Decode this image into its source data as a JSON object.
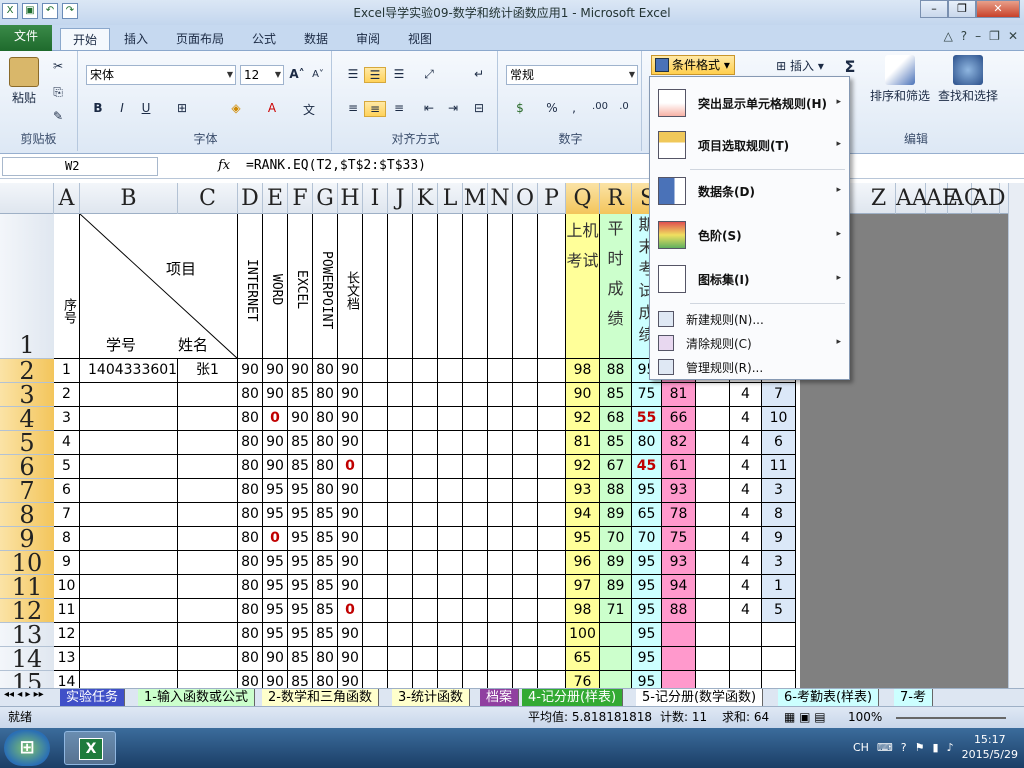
{
  "window": {
    "title": "Excel导学实验09-数学和统计函数应用1 - Microsoft Excel"
  },
  "ribbon_tabs": [
    "文件",
    "开始",
    "插入",
    "页面布局",
    "公式",
    "数据",
    "审阅",
    "视图"
  ],
  "ribbon": {
    "paste": "粘贴",
    "clipboard": "剪贴板",
    "font_name": "宋体",
    "font_size": "12",
    "font_group": "字体",
    "align_group": "对齐方式",
    "number_format": "常规",
    "number_group": "数字",
    "cf_button": "条件格式",
    "insert": "插入",
    "edit_group": "编辑",
    "sort_filter": "排序和筛选",
    "find_select": "查找和选择",
    "bold": "B",
    "italic": "I",
    "underline": "U"
  },
  "formula_bar": {
    "cell_ref": "W2",
    "fx": "fx",
    "formula": "=RANK.EQ(T2,$T$2:$T$33)"
  },
  "cf_menu": {
    "items": [
      {
        "label": "突出显示单元格规则(H)",
        "arrow": "▸"
      },
      {
        "label": "项目选取规则(T)",
        "arrow": "▸"
      },
      {
        "label": "数据条(D)",
        "arrow": "▸"
      },
      {
        "label": "色阶(S)",
        "arrow": "▸"
      },
      {
        "label": "图标集(I)",
        "arrow": "▸"
      }
    ],
    "small_items": [
      {
        "label": "新建规则(N)...",
        "arrow": ""
      },
      {
        "label": "清除规则(C)",
        "arrow": "▸"
      },
      {
        "label": "管理规则(R)...",
        "arrow": ""
      }
    ]
  },
  "columns": [
    "A",
    "B",
    "C",
    "D",
    "E",
    "F",
    "G",
    "H",
    "I",
    "J",
    "K",
    "L",
    "M",
    "N",
    "O",
    "P",
    "Q",
    "R",
    "S",
    "Z",
    "AA",
    "AE",
    "AC",
    "AD"
  ],
  "header_row": {
    "a": "序号",
    "xiangmu": "项目",
    "xuehao": "学号",
    "xingming": "姓名",
    "d": "INTERNET",
    "e": "WORD",
    "f": "EXCEL",
    "g": "POWERPOINT",
    "h": "长文档",
    "q": "上机考试",
    "r": "平时成绩",
    "s": "期末考试成绩"
  },
  "row_numbers": [
    "1",
    "2",
    "3",
    "4",
    "5",
    "6",
    "7",
    "8",
    "9",
    "10",
    "11",
    "12",
    "13",
    "14",
    "15"
  ],
  "rows": [
    {
      "a": "1",
      "b": "1404333601",
      "c": "张1",
      "d": "90",
      "e": "90",
      "f": "90",
      "g": "80",
      "h": "90",
      "q": "98",
      "r": "88",
      "s": "95",
      "t": "",
      "v": "",
      "w": ""
    },
    {
      "a": "2",
      "b": "",
      "c": "",
      "d": "80",
      "e": "90",
      "f": "85",
      "g": "80",
      "h": "90",
      "q": "90",
      "r": "85",
      "s": "75",
      "t": "81",
      "v": "4",
      "w": "7"
    },
    {
      "a": "3",
      "b": "",
      "c": "",
      "d": "80",
      "e": "0",
      "f": "90",
      "g": "80",
      "h": "90",
      "q": "92",
      "r": "68",
      "s": "55",
      "t": "66",
      "v": "4",
      "w": "10"
    },
    {
      "a": "4",
      "b": "",
      "c": "",
      "d": "80",
      "e": "90",
      "f": "85",
      "g": "80",
      "h": "90",
      "q": "81",
      "r": "85",
      "s": "80",
      "t": "82",
      "v": "4",
      "w": "6"
    },
    {
      "a": "5",
      "b": "",
      "c": "",
      "d": "80",
      "e": "90",
      "f": "85",
      "g": "80",
      "h": "0",
      "q": "92",
      "r": "67",
      "s": "45",
      "t": "61",
      "v": "4",
      "w": "11"
    },
    {
      "a": "6",
      "b": "",
      "c": "",
      "d": "80",
      "e": "95",
      "f": "95",
      "g": "80",
      "h": "90",
      "q": "93",
      "r": "88",
      "s": "95",
      "t": "93",
      "v": "4",
      "w": "3"
    },
    {
      "a": "7",
      "b": "",
      "c": "",
      "d": "80",
      "e": "95",
      "f": "95",
      "g": "85",
      "h": "90",
      "q": "94",
      "r": "89",
      "s": "65",
      "t": "78",
      "v": "4",
      "w": "8"
    },
    {
      "a": "8",
      "b": "",
      "c": "",
      "d": "80",
      "e": "0",
      "f": "95",
      "g": "85",
      "h": "90",
      "q": "95",
      "r": "70",
      "s": "70",
      "t": "75",
      "v": "4",
      "w": "9"
    },
    {
      "a": "9",
      "b": "",
      "c": "",
      "d": "80",
      "e": "95",
      "f": "95",
      "g": "85",
      "h": "90",
      "q": "96",
      "r": "89",
      "s": "95",
      "t": "93",
      "v": "4",
      "w": "3"
    },
    {
      "a": "10",
      "b": "",
      "c": "",
      "d": "80",
      "e": "95",
      "f": "95",
      "g": "85",
      "h": "90",
      "q": "97",
      "r": "89",
      "s": "95",
      "t": "94",
      "v": "4",
      "w": "1"
    },
    {
      "a": "11",
      "b": "",
      "c": "",
      "d": "80",
      "e": "95",
      "f": "95",
      "g": "85",
      "h": "0",
      "q": "98",
      "r": "71",
      "s": "95",
      "t": "88",
      "v": "4",
      "w": "5"
    },
    {
      "a": "12",
      "b": "",
      "c": "",
      "d": "80",
      "e": "95",
      "f": "95",
      "g": "85",
      "h": "90",
      "q": "100",
      "r": "",
      "s": "95",
      "t": "",
      "v": "",
      "w": ""
    },
    {
      "a": "13",
      "b": "",
      "c": "",
      "d": "80",
      "e": "90",
      "f": "85",
      "g": "80",
      "h": "90",
      "q": "65",
      "r": "",
      "s": "95",
      "t": "",
      "v": "",
      "w": ""
    },
    {
      "a": "14",
      "b": "",
      "c": "",
      "d": "80",
      "e": "90",
      "f": "85",
      "g": "80",
      "h": "90",
      "q": "76",
      "r": "",
      "s": "95",
      "t": "",
      "v": "",
      "w": ""
    }
  ],
  "sheet_tabs": [
    "实验任务",
    "1-输入函数或公式",
    "2-数学和三角函数",
    "3-统计函数",
    "档案",
    "4-记分册(样表)",
    "5-记分册(数学函数)",
    "6-考勤表(样表)",
    "7-考"
  ],
  "status": {
    "ready": "就绪",
    "average": "平均值: 5.818181818",
    "count": "计数: 11",
    "sum": "求和: 64",
    "zoom": "100%"
  },
  "taskbar": {
    "lang": "CH",
    "time": "15:17",
    "date": "2015/5/29"
  },
  "colors": {
    "yellow": "#ffff99",
    "green": "#ccffcc",
    "cyan": "#ccffff",
    "pink": "#ff99cc",
    "blue": "#dbe8f8"
  }
}
